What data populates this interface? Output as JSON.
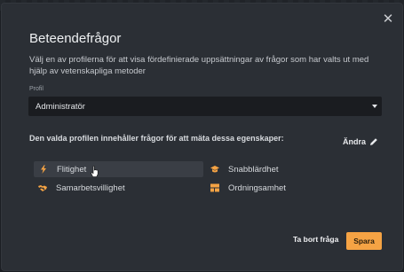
{
  "dialog": {
    "title": "Beteendefrågor",
    "description": "Välj en av profilerna för att visa fördefinierade uppsättningar av frågor som har valts ut med hjälp av vetenskapliga metoder",
    "profile_label": "Profil",
    "profile_value": "Administratör",
    "properties_heading": "Den valda profilen innehåller frågor för att mäta dessa egenskaper:",
    "edit_label": "Ändra",
    "properties": [
      {
        "label": "Flitighet",
        "icon": "lightning-bolt-icon",
        "color": "#f5a344"
      },
      {
        "label": "Snabblärdhet",
        "icon": "graduation-cap-icon",
        "color": "#f5a344"
      },
      {
        "label": "Samarbetsvillighet",
        "icon": "handshake-icon",
        "color": "#f5a344"
      },
      {
        "label": "Ordningsamhet",
        "icon": "grid-blocks-icon",
        "color": "#f5a344"
      }
    ],
    "buttons": {
      "delete": "Ta bort fråga",
      "save": "Spara"
    },
    "close_symbol": "✕"
  },
  "colors": {
    "accent": "#f5a344",
    "modal_bg": "#2b2f35",
    "select_bg": "#1a1c20"
  }
}
